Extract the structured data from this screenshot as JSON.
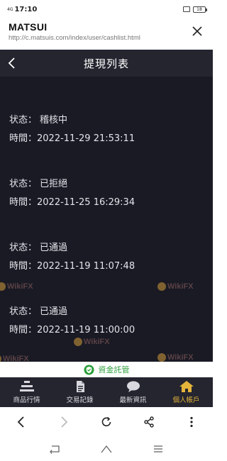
{
  "status_bar": {
    "signal": "4G",
    "time": "17:10",
    "battery": "18"
  },
  "browser": {
    "site_title": "MATSUI",
    "url": "http://c.matsuis.com/index/user/cashlist.html"
  },
  "page": {
    "title": "提現列表"
  },
  "records": [
    {
      "id": "",
      "status_label": "状态：",
      "status": "稽核中",
      "time_label": "時間：",
      "time": "2022-11-29 21:53:11"
    },
    {
      "id": "",
      "status_label": "状态：",
      "status": "已拒絕",
      "time_label": "時間：",
      "time": "2022-11-25 16:29:34"
    },
    {
      "id": "",
      "status_label": "状态：",
      "status": "已通過",
      "time_label": "時間：",
      "time": "2022-11-19 11:07:48"
    },
    {
      "id": "",
      "status_label": "状态：",
      "status": "已通過",
      "time_label": "時間：",
      "time": "2022-11-19 11:00:00"
    }
  ],
  "watermark": "WikiFX",
  "custody": {
    "label": "資金託管",
    "color": "#2a9e3a"
  },
  "tabs": [
    {
      "label": "商品行情",
      "icon": "list-icon"
    },
    {
      "label": "交易記錄",
      "icon": "document-icon"
    },
    {
      "label": "最新資訊",
      "icon": "chat-bubble-icon"
    },
    {
      "label": "個人帳戶",
      "icon": "home-icon",
      "active": true
    }
  ],
  "colors": {
    "nav_background": "#24252f",
    "content_background": "#191a24",
    "active_tab": "#e5b43a"
  }
}
